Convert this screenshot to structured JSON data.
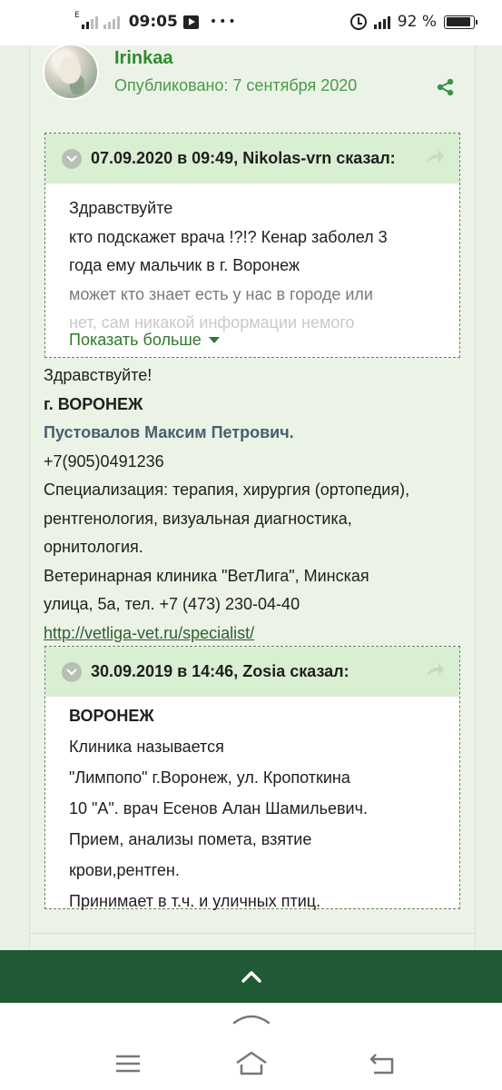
{
  "status_bar": {
    "network_type": "E",
    "time": "09:05",
    "overflow_dots": "•••",
    "battery_text": "92 %",
    "battery_level": 0.92
  },
  "author": {
    "name": "Irinkaa",
    "published": "Опубликовано: 7 сентября 2020"
  },
  "quotes": [
    {
      "header": "07.09.2020 в 09:49, Nikolas-vrn сказал:",
      "lines": [
        "Здравствуйте",
        "кто подскажет врача !?!? Кенар заболел 3",
        "года ему мальчик в г. Воронеж",
        "может кто знает есть у нас в городе или",
        "нет, сам никакой информации немого"
      ],
      "show_more": "Показать больше"
    },
    {
      "header": "30.09.2019 в 14:46, Zosia сказал:",
      "title": "ВОРОНЕЖ",
      "lines": [
        "Клиника называется",
        "\"Лимпопо\"  г.Воронеж, ул. Кропоткина",
        "10 \"А\". врач Есенов Алан Шамильевич.",
        "Прием, анализы помета, взятие",
        "крови,рентген.",
        "Принимает в т.ч. и уличных птиц."
      ]
    }
  ],
  "post": {
    "greeting": "Здравствуйте!",
    "city": "г. ВОРОНЕЖ",
    "doctor": "Пустовалов Максим Петрович.",
    "phone": "+7(905)0491236",
    "spec_lines": [
      "Специализация: терапия, хирургия (ортопедия),",
      "рентгенология, визуальная диагностика,",
      "орнитология."
    ],
    "clinic_lines": [
      "Ветеринарная клиника \"ВетЛига\", Минская",
      "улица, 5а, тел. +7 (473) 230-04-40"
    ],
    "link": "http://vetliga-vet.ru/specialist/"
  },
  "colors": {
    "accent_green": "#2e8b2e",
    "quote_header_bg": "#d9efd2",
    "scroll_bar_bg": "#1f5a34",
    "page_bg": "#eaf3e6"
  },
  "icons": {
    "share": "share-icon",
    "reply": "reply-icon",
    "scroll_top": "chevron-up-icon",
    "nav_menu": "menu-icon",
    "nav_home": "home-icon",
    "nav_back": "back-icon"
  }
}
